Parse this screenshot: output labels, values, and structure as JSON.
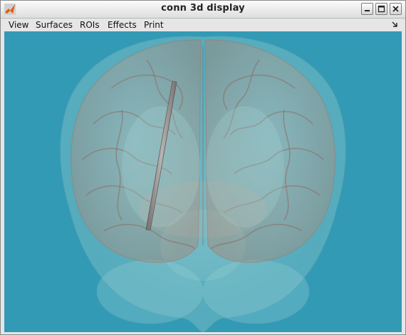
{
  "window": {
    "title": "conn 3d display",
    "controls": [
      "minimize-icon",
      "maximize-icon",
      "close-icon"
    ]
  },
  "menu": {
    "items": [
      "View",
      "Surfaces",
      "ROIs",
      "Effects",
      "Print"
    ],
    "dock_icon": "dock-arrow-icon"
  },
  "canvas": {
    "background": "#339ab5",
    "shell_color": "#7ec3c9",
    "cortex_color": "#b8998a",
    "sulci_color": "#8e6a60",
    "rod_color": "#8d8a88"
  }
}
